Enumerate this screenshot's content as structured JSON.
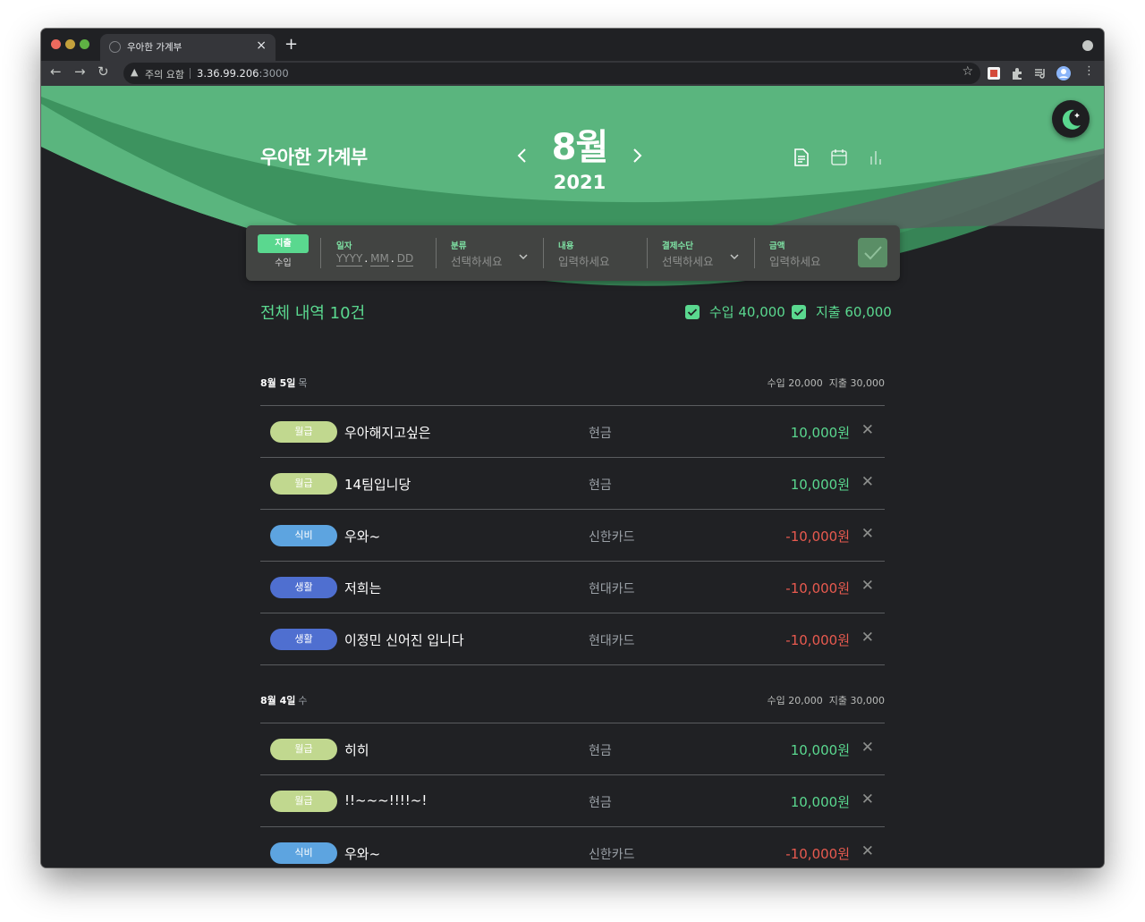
{
  "browser": {
    "tab_title": "우아한 가계부",
    "security_label": "주의 요함",
    "url_host": "3.36.99.206",
    "url_port": ":3000"
  },
  "header": {
    "app_title": "우아한 가계부",
    "month": "8월",
    "year": "2021",
    "icons": [
      "document-icon",
      "calendar-icon",
      "bar-chart-icon"
    ]
  },
  "entry_form": {
    "type_expense": "지출",
    "type_income": "수입",
    "date_label": "일자",
    "date_parts": [
      "YYYY",
      "MM",
      "DD"
    ],
    "category_label": "분류",
    "category_value": "선택하세요",
    "content_label": "내용",
    "content_placeholder": "입력하세요",
    "payment_label": "결제수단",
    "payment_value": "선택하세요",
    "amount_label": "금액",
    "amount_placeholder": "입력하세요"
  },
  "summary": {
    "title": "전체 내역 10건",
    "income_filter": "수입 40,000",
    "expense_filter": "지출 60,000"
  },
  "days": [
    {
      "date": "8월 5일",
      "weekday": "목",
      "income_total": "수입 20,000",
      "expense_total": "지출 30,000",
      "items": [
        {
          "category": "월급",
          "content": "우아해지고싶은",
          "method": "현금",
          "amount": "10,000원",
          "kind": "income"
        },
        {
          "category": "월급",
          "content": "14팀입니당",
          "method": "현금",
          "amount": "10,000원",
          "kind": "income"
        },
        {
          "category": "식비",
          "content": "우와~",
          "method": "신한카드",
          "amount": "-10,000원",
          "kind": "expense"
        },
        {
          "category": "생활",
          "content": "저희는",
          "method": "현대카드",
          "amount": "-10,000원",
          "kind": "expense"
        },
        {
          "category": "생활",
          "content": "이정민 신어진 입니다",
          "method": "현대카드",
          "amount": "-10,000원",
          "kind": "expense"
        }
      ]
    },
    {
      "date": "8월 4일",
      "weekday": "수",
      "income_total": "수입 20,000",
      "expense_total": "지출 30,000",
      "items": [
        {
          "category": "월급",
          "content": "히히",
          "method": "현금",
          "amount": "10,000원",
          "kind": "income"
        },
        {
          "category": "월급",
          "content": "!!~~~!!!!~!",
          "method": "현금",
          "amount": "10,000원",
          "kind": "income"
        },
        {
          "category": "식비",
          "content": "우와~",
          "method": "신한카드",
          "amount": "-10,000원",
          "kind": "expense"
        }
      ]
    }
  ],
  "colors": {
    "accent": "#5ad88f",
    "income": "#5ad88f",
    "expense": "#e85a4f",
    "tag_salary": "#c1d88f",
    "tag_food": "#5da4e0",
    "tag_living": "#4f6fd0",
    "hero": "#5ab57e"
  }
}
